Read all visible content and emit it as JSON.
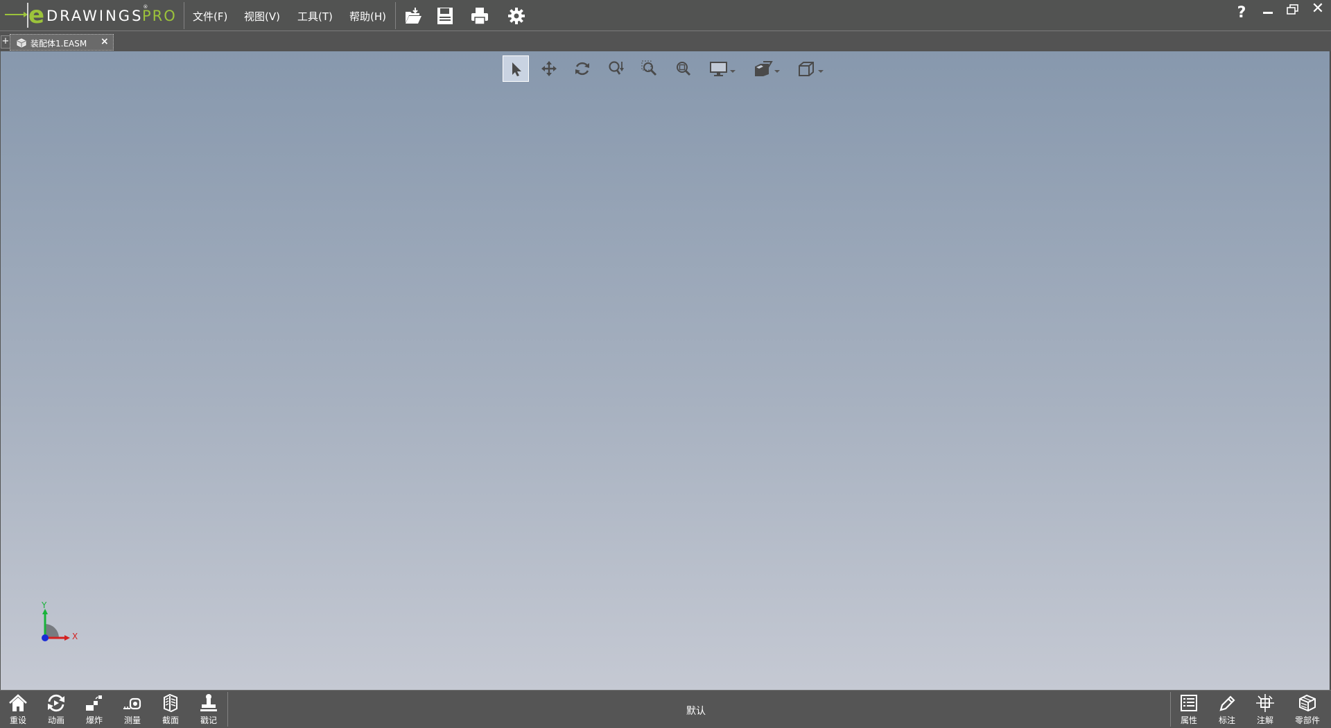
{
  "app": {
    "logo_word": "DRAWINGS",
    "logo_reg": "®",
    "logo_pro": "PRO"
  },
  "menu": {
    "file": "文件(F)",
    "view": "视图(V)",
    "tools": "工具(T)",
    "help": "帮助(H)"
  },
  "toolbar_icons": [
    "open-folder-icon",
    "save-icon",
    "print-icon",
    "settings-gear-icon"
  ],
  "window_controls": {
    "help": "?",
    "close": "✕"
  },
  "document_tab": {
    "add": "+",
    "name": "装配体1.EASM",
    "close": "×"
  },
  "view_toolbar": [
    {
      "name": "select-tool",
      "icon": "arrow-cursor-icon",
      "active": true
    },
    {
      "name": "pan-tool",
      "icon": "move-arrows-icon"
    },
    {
      "name": "rotate-tool",
      "icon": "rotate-icon"
    },
    {
      "name": "zoom-tool",
      "icon": "zoom-updown-icon"
    },
    {
      "name": "zoom-area-tool",
      "icon": "zoom-area-icon"
    },
    {
      "name": "zoom-fit-tool",
      "icon": "zoom-fit-icon"
    },
    {
      "name": "display-style-dropdown",
      "icon": "monitor-icon"
    },
    {
      "name": "section-view-dropdown",
      "icon": "section-cube-icon"
    },
    {
      "name": "standard-views-dropdown",
      "icon": "view-cube-icon"
    }
  ],
  "triad": {
    "y_label": "Y",
    "x_label": "X"
  },
  "bottom_left": [
    {
      "label": "重设",
      "icon": "home-icon"
    },
    {
      "label": "动画",
      "icon": "animate-icon"
    },
    {
      "label": "爆炸",
      "icon": "explode-icon"
    },
    {
      "label": "测量",
      "icon": "measure-icon"
    },
    {
      "label": "截面",
      "icon": "section-icon"
    },
    {
      "label": "戳记",
      "icon": "stamp-icon"
    }
  ],
  "configuration": "默认",
  "bottom_right": [
    {
      "label": "属性",
      "icon": "properties-icon"
    },
    {
      "label": "标注",
      "icon": "markup-pencil-icon"
    },
    {
      "label": "注解",
      "icon": "annotation-icon"
    },
    {
      "label": "零部件",
      "icon": "components-icon"
    }
  ],
  "colors": {
    "bar": "#525352",
    "logo_accent": "#9cc33b",
    "viewport_top": "#8798ad",
    "viewport_bottom": "#c5c9d3"
  }
}
